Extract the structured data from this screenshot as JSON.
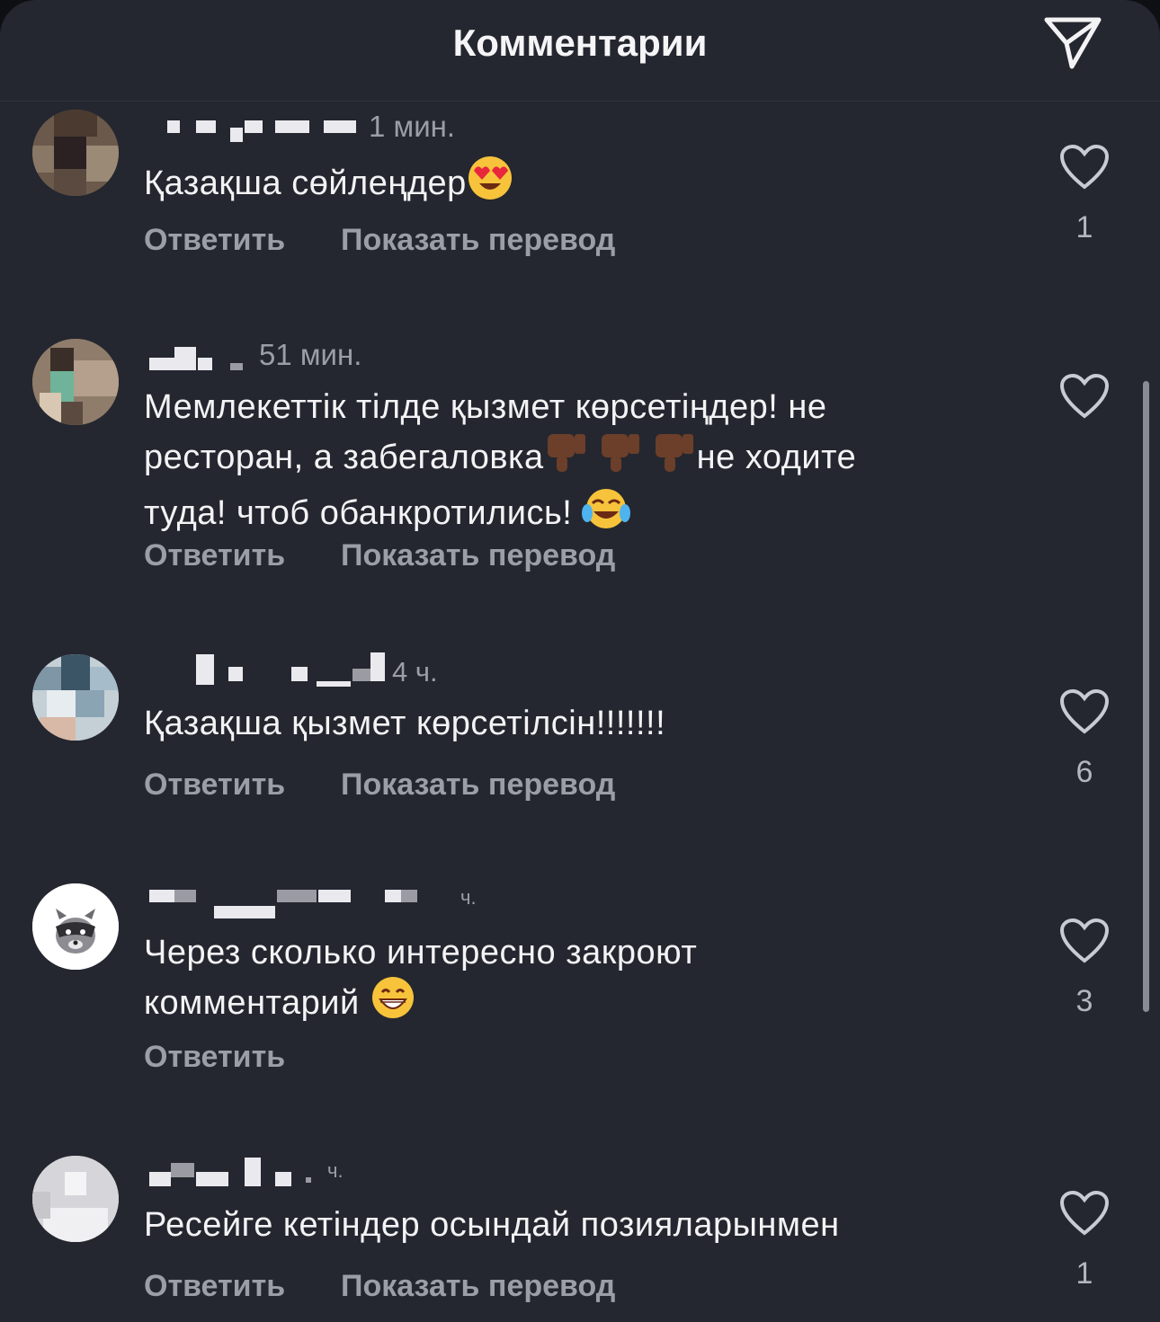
{
  "header": {
    "title": "Комментарии",
    "send_icon": "send-icon"
  },
  "labels": {
    "reply": "Ответить",
    "translate": "Показать перевод"
  },
  "colors": {
    "sheet": "#24272f",
    "text": "#f3f3f5",
    "muted": "#9c9ea6"
  },
  "comments": [
    {
      "time": "1 мин.",
      "text": "Қазақша сөйлеңдер",
      "emoji": "heart-eyes-emoji",
      "likes": "1",
      "has_translate": true
    },
    {
      "time": "51 мин.",
      "text_line1": "Мемлекеттік тілде қызмет көрсетіңдер! не",
      "text_line2_a": "ресторан, а забегаловка",
      "text_line2_b": "не ходите",
      "text_line3": "туда! чтоб обанкротились!",
      "emoji": "thumbs-down-emoji",
      "emoji2": "tears-of-joy-emoji",
      "likes": "",
      "has_translate": true
    },
    {
      "time": "4 ч.",
      "text": "Қазақша қызмет көрсетілсін!!!!!!!",
      "likes": "6",
      "has_translate": true
    },
    {
      "time": "ч.",
      "text_line1": "Через сколько интересно закроют",
      "text_line2": "комментарий",
      "emoji": "grinning-emoji",
      "likes": "3",
      "has_translate": false
    },
    {
      "time": "ч.",
      "text": "Ресейге кетіндер осындай позияларынмен",
      "likes": "1",
      "has_translate": true
    }
  ]
}
